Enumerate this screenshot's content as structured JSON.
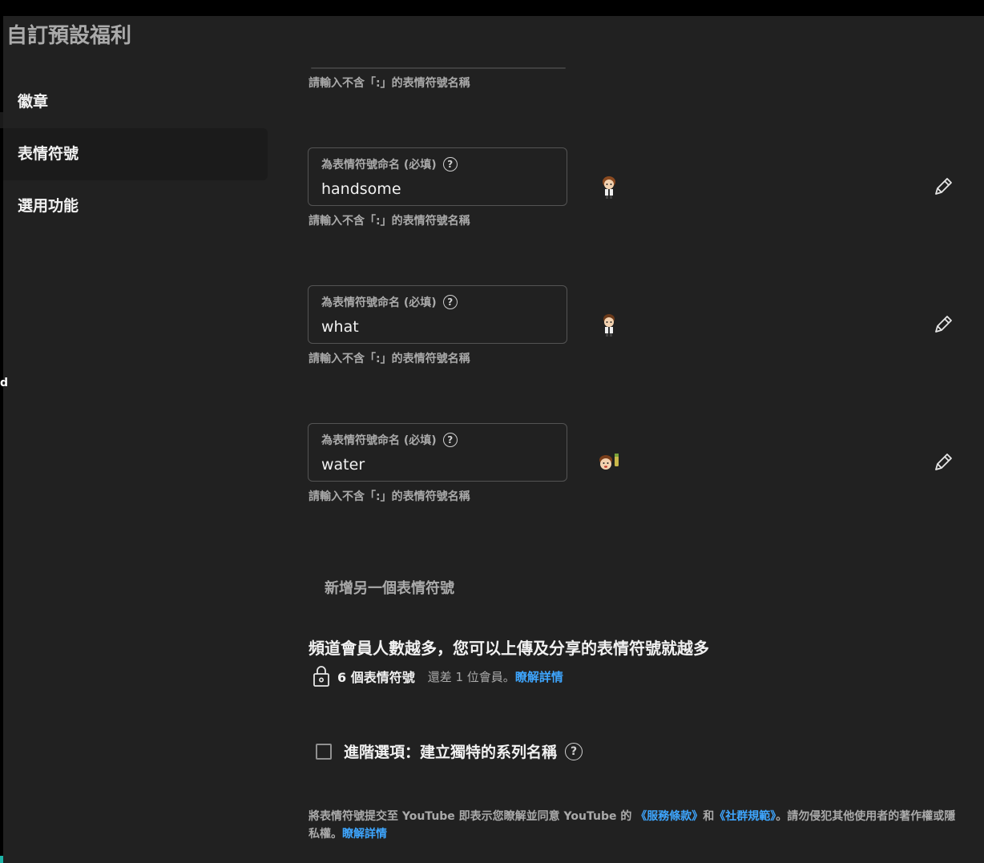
{
  "page_title": "自訂預設福利",
  "sidebar": {
    "items": [
      {
        "label": "徽章",
        "active": false
      },
      {
        "label": "表情符號",
        "active": true
      },
      {
        "label": "選用功能",
        "active": false
      }
    ]
  },
  "emoji_hint": "請輸入不含「:」的表情符號名稱",
  "emoji_field_label": "為表情符號命名 (必填)",
  "help_glyph": "?",
  "emojis": [
    {
      "name": "handsome",
      "icon": "cartoon-person-icon"
    },
    {
      "name": "what",
      "icon": "cartoon-person-icon"
    },
    {
      "name": "water",
      "icon": "cartoon-face-water-icon"
    }
  ],
  "add_emoji_label": "新增另一個表情符號",
  "members": {
    "heading": "頻道會員人數越多，您可以上傳及分享的表情符號就越多",
    "lock_count": "6 個表情符號",
    "remaining_text": "還差 1 位會員。",
    "learn_more": "瞭解詳情"
  },
  "advanced": {
    "label": "進階選項：建立獨特的系列名稱",
    "checked": false
  },
  "legal": {
    "part1": "將表情符號提交至 YouTube 即表示您瞭解並同意 YouTube 的",
    "terms": "《服務條款》",
    "and": "和",
    "guidelines": "《社群規範》",
    "part2": "。請勿侵犯其他使用者的著作權或隱私權。",
    "learn_more": "瞭解詳情"
  },
  "edge_letter": "d",
  "colors": {
    "background": "#212121",
    "link": "#3ea6ff",
    "text_primary": "#f1f1f1",
    "text_secondary": "#aaaaaa"
  }
}
